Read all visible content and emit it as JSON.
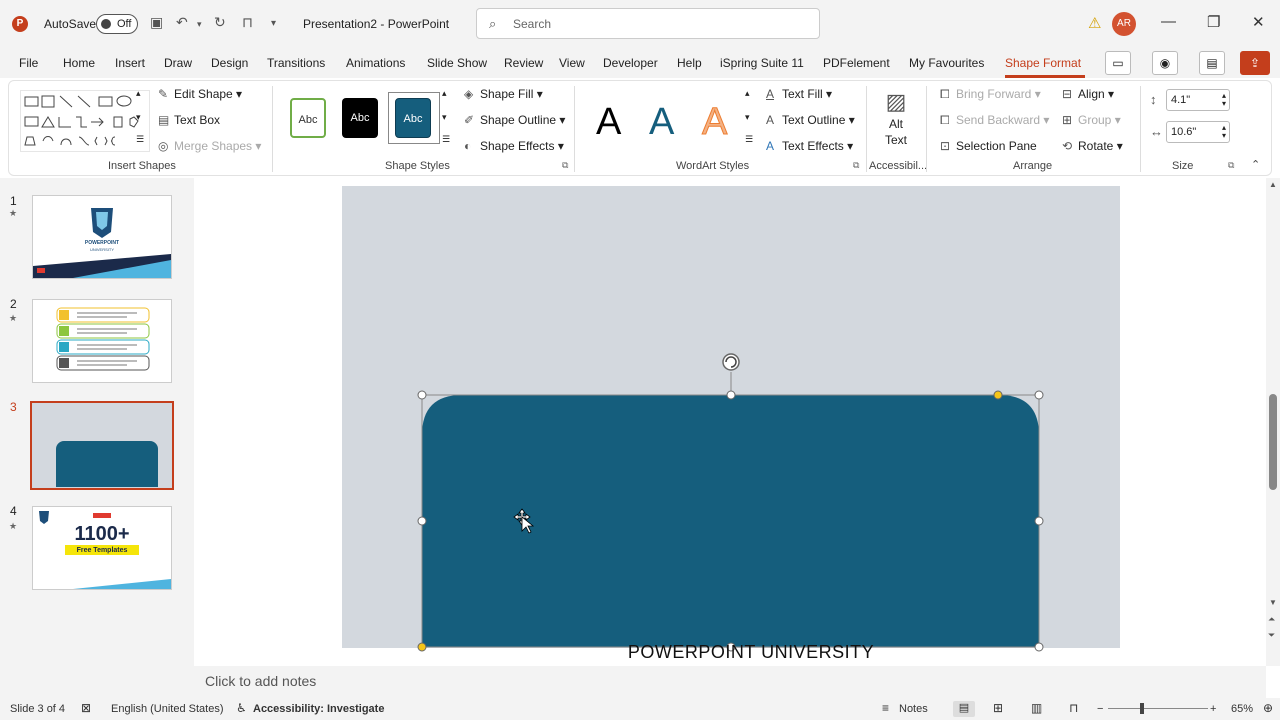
{
  "titlebar": {
    "autosave_label": "AutoSave",
    "autosave_state": "Off",
    "doc_title": "Presentation2  -  PowerPoint",
    "search_placeholder": "Search",
    "user_initials": "AR"
  },
  "menu": {
    "items": [
      "File",
      "Home",
      "Insert",
      "Draw",
      "Design",
      "Transitions",
      "Animations",
      "Slide Show",
      "Review",
      "View",
      "Developer",
      "Help",
      "iSpring Suite 11",
      "PDFelement",
      "My Favourites",
      "Shape Format"
    ],
    "active": "Shape Format"
  },
  "ribbon": {
    "insert_shapes": {
      "edit_shape": "Edit Shape",
      "text_box": "Text Box",
      "merge_shapes": "Merge Shapes",
      "label": "Insert Shapes"
    },
    "shape_styles": {
      "thumb_text": "Abc",
      "shape_fill": "Shape Fill",
      "shape_outline": "Shape Outline",
      "shape_effects": "Shape Effects",
      "label": "Shape Styles"
    },
    "wordart": {
      "letter": "A",
      "text_fill": "Text Fill",
      "text_outline": "Text Outline",
      "text_effects": "Text Effects",
      "label": "WordArt Styles"
    },
    "accessibility": {
      "alt_text_line1": "Alt",
      "alt_text_line2": "Text",
      "label": "Accessibil..."
    },
    "arrange": {
      "bring_forward": "Bring Forward",
      "send_backward": "Send Backward",
      "selection_pane": "Selection Pane",
      "align": "Align",
      "group": "Group",
      "rotate": "Rotate",
      "label": "Arrange"
    },
    "size": {
      "height": "4.1\"",
      "width": "10.6\"",
      "label": "Size"
    }
  },
  "slides": {
    "numbers": [
      "1",
      "2",
      "3",
      "4"
    ],
    "selected": "3",
    "thumb1_title": "POWERPOINT",
    "thumb1_sub": "UNIVERSITY",
    "thumb4_big": "1100+",
    "thumb4_label": "Free Templates"
  },
  "slide": {
    "footer_text": "POWERPOINT UNIVERSITY",
    "shape_color": "#155e7d"
  },
  "notes": {
    "placeholder": "Click to add notes"
  },
  "status": {
    "slide_info": "Slide 3 of 4",
    "language": "English (United States)",
    "accessibility": "Accessibility: Investigate",
    "notes": "Notes",
    "zoom": "65%"
  },
  "colors": {
    "accent": "#c43e1c",
    "shape": "#155e7d",
    "slide_bg": "#d3d8de",
    "handle_yellow": "#f5c518"
  }
}
